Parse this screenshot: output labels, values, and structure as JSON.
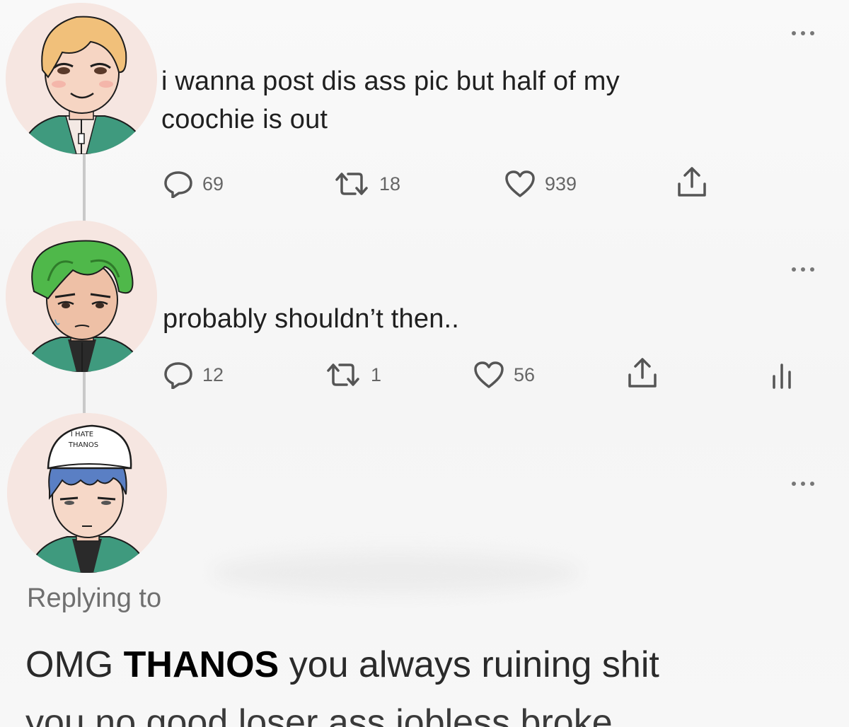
{
  "tweets": [
    {
      "text_line1": "i wanna post dis ass pic but half of my",
      "text_line2": "coochie is out",
      "replies": "69",
      "retweets": "18",
      "likes": "939"
    },
    {
      "text_line1": "probably shouldn’t then..",
      "replies": "12",
      "retweets": "1",
      "likes": "56"
    }
  ],
  "avatars": {
    "blonde": "cartoon-blonde-avatar",
    "green_hair": "cartoon-green-hair-avatar",
    "hat": {
      "name": "cartoon-hat-avatar",
      "hat_text_line1": "I HATE",
      "hat_text_line2": "THANOS"
    }
  },
  "reply": {
    "replying_label": "Replying to",
    "text_prefix": "OMG",
    "text_highlight": "THANOS",
    "text_suffix": "you always ruining shit",
    "text_line2": "you no good loser ass jobless broke"
  },
  "colors": {
    "icon_gray": "#666666",
    "text_dark": "#202020",
    "thread_line": "#c9c9c9",
    "jacket_green": "#3f9a7e",
    "hair_green": "#4fb84a",
    "hair_blonde": "#f1c07a",
    "hair_blue": "#5a7fc4"
  },
  "icons": {
    "reply": "reply-icon",
    "retweet": "retweet-icon",
    "like": "heart-icon",
    "share": "share-icon",
    "more": "more-dots-icon",
    "analytics": "analytics-icon"
  }
}
